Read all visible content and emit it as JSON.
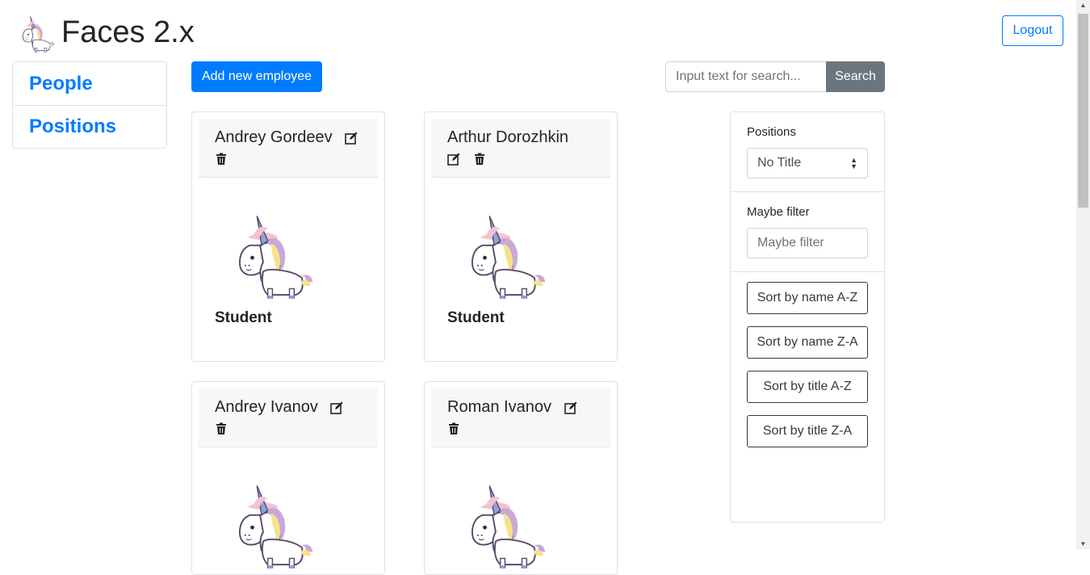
{
  "app": {
    "title": "Faces 2.x",
    "logout_label": "Logout"
  },
  "nav": {
    "items": [
      {
        "label": "People"
      },
      {
        "label": "Positions"
      }
    ]
  },
  "toolbar": {
    "add_label": "Add new employee",
    "search_placeholder": "Input text for search...",
    "search_label": "Search"
  },
  "employees": [
    {
      "name": "Andrey Gordeev",
      "title": "Student"
    },
    {
      "name": "Arthur Dorozhkin",
      "title": "Student"
    },
    {
      "name": "Andrey Ivanov",
      "title": ""
    },
    {
      "name": "Roman Ivanov",
      "title": ""
    }
  ],
  "filters": {
    "positions_label": "Positions",
    "positions_selected": "No Title",
    "maybe_filter_label": "Maybe filter",
    "maybe_filter_placeholder": "Maybe filter",
    "sort_buttons": [
      {
        "label": "Sort by name A-Z"
      },
      {
        "label": "Sort by name Z-A"
      },
      {
        "label": "Sort by title A-Z"
      },
      {
        "label": "Sort by title Z-A"
      }
    ]
  },
  "icons": {
    "edit": "edit-icon",
    "delete": "trash-icon",
    "logo": "unicorn-logo"
  },
  "colors": {
    "primary": "#007bff",
    "secondary": "#6c757d",
    "dark": "#343a40"
  }
}
